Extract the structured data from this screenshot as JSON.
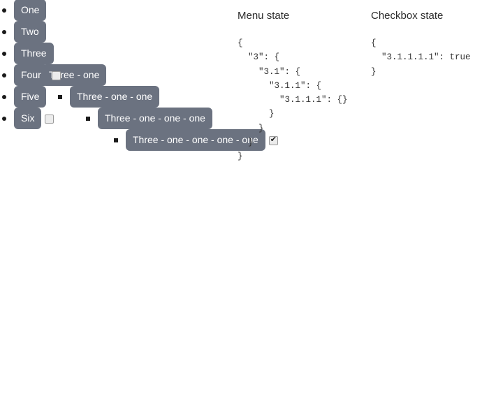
{
  "menu": {
    "items": [
      {
        "id": "1",
        "label": "One",
        "marker": "disc",
        "level": 1,
        "checkbox": "none",
        "children": []
      },
      {
        "id": "2",
        "label": "Two",
        "marker": "disc",
        "level": 1,
        "checkbox": "none",
        "children": []
      },
      {
        "id": "3",
        "label": "Three",
        "marker": "disc",
        "level": 1,
        "checkbox": "none",
        "children": [
          {
            "id": "3.1",
            "label": "Three - one",
            "marker": "circle",
            "level": 2,
            "checkbox": "none",
            "children": [
              {
                "id": "3.1.1",
                "label": "Three - one - one",
                "marker": "square",
                "level": 3,
                "checkbox": "none",
                "children": [
                  {
                    "id": "3.1.1.1",
                    "label": "Three - one - one - one",
                    "marker": "square",
                    "level": 4,
                    "checkbox": "none",
                    "children": [
                      {
                        "id": "3.1.1.1.1",
                        "label": "Three - one - one - one - one",
                        "marker": "square",
                        "level": 5,
                        "checkbox": "checked",
                        "children": []
                      }
                    ]
                  }
                ]
              }
            ]
          }
        ]
      },
      {
        "id": "4",
        "label": "Four",
        "marker": "disc",
        "level": 1,
        "checkbox": "unchecked",
        "children": []
      },
      {
        "id": "5",
        "label": "Five",
        "marker": "disc",
        "level": 1,
        "checkbox": "none",
        "children": []
      },
      {
        "id": "6",
        "label": "Six",
        "marker": "disc",
        "level": 1,
        "checkbox": "unchecked",
        "children": []
      }
    ]
  },
  "panels": {
    "menu_state": {
      "title": "Menu state",
      "json": "{\n  \"3\": {\n    \"3.1\": {\n      \"3.1.1\": {\n        \"3.1.1.1\": {}\n      }\n    }\n  }\n}"
    },
    "checkbox_state": {
      "title": "Checkbox state",
      "json": "{\n  \"3.1.1.1.1\": true\n}"
    }
  },
  "colors": {
    "menu_item_bg": "#6b7280",
    "menu_item_text": "#ffffff",
    "heading_text": "#2b2b2b",
    "json_text": "#333333",
    "page_bg": "#ffffff",
    "checkbox_bg": "#ececec",
    "checkbox_border": "#9a9a9a",
    "checkmark": "#1a1a1a"
  }
}
